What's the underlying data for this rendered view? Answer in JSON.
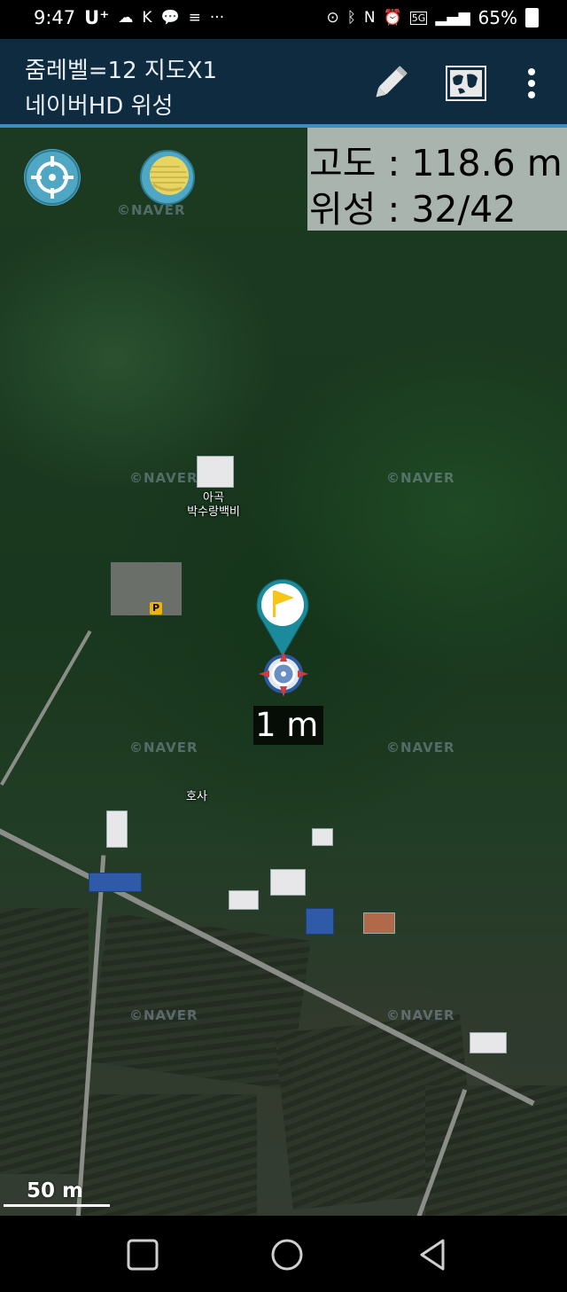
{
  "status_bar": {
    "time": "9:47",
    "carrier": "U⁺",
    "battery": "65%",
    "network": "5G"
  },
  "app_bar": {
    "line1": "줌레벨=12 지도X1",
    "line2": "네이버HD 위성",
    "icons": [
      "pencil-icon",
      "map-layer-icon",
      "more-vert-icon"
    ]
  },
  "map": {
    "info": {
      "altitude": "고도 : 118.6 m",
      "satellites": "위성 : 32/42"
    },
    "watermark": "©NAVER",
    "pois": {
      "poi1_line1": "아곡",
      "poi1_line2": "박수랑백비",
      "poi2": "호사",
      "parking": "P"
    },
    "distance_label": "1 m",
    "scale_label": "50 m"
  },
  "colors": {
    "app_bar_bg": "#0f2b3f",
    "accent_line": "#3a8fc2",
    "marker_teal": "#1b8a9a",
    "marker_flag": "#f5c518"
  }
}
